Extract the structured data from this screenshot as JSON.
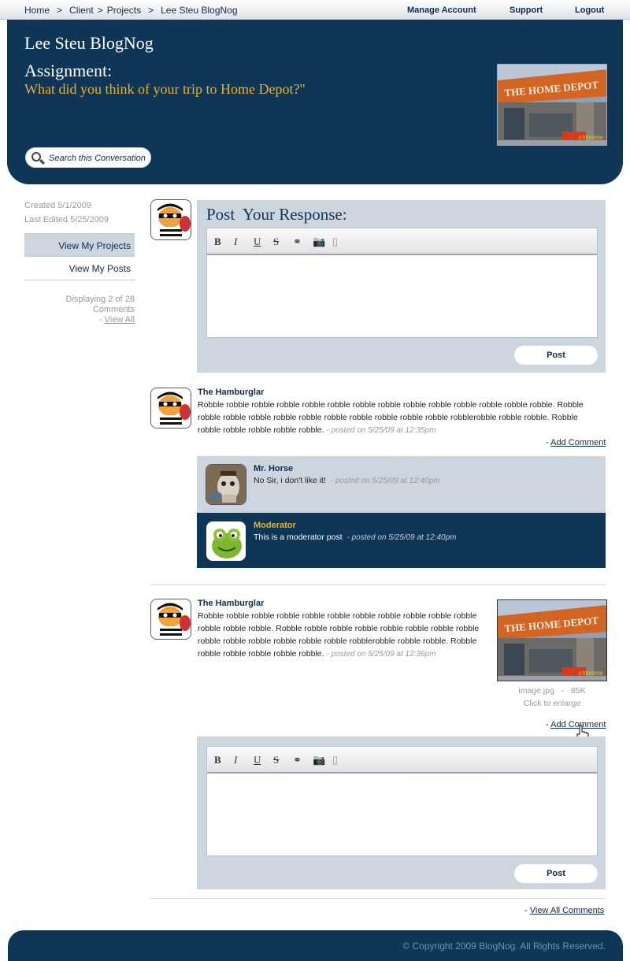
{
  "topnav": {
    "crumbs": [
      "Home",
      "Client",
      "Projects",
      "Lee Steu BlogNog"
    ],
    "sep": ">",
    "manage": "Manage Account",
    "support": "Support",
    "logout": "Logout"
  },
  "header": {
    "blog_title": "Lee Steu BlogNog",
    "assignment_label": "Assignment:",
    "assignment_question": "What did you think of your trip to Home Depot?\"",
    "search_label": "Search this Conversation",
    "photo_sign": "THE HOME DEPOT",
    "photo_date": "07/23/2009"
  },
  "sidebar": {
    "created": "Created 5/1/2009",
    "edited": "Last Edited 5/25/2009",
    "nav": [
      "View My Projects",
      "View My Posts"
    ],
    "displaying": "Displaying 2 of 28 Comments",
    "view_all_prefix": "- ",
    "view_all": "View All"
  },
  "response": {
    "title": "Post  Your Response:",
    "post_label": "Post"
  },
  "toolbar": {
    "bold": "B",
    "italic": "I",
    "underline": "U",
    "strike": "S"
  },
  "posts": [
    {
      "author": "The Hamburglar",
      "text": "Robble robble robble robble robble robble robble robble robble robble robble robble robble robble. Robble robble robble robble robble robble robble robble robble robble robble robblerobble robble robble. Robble robble robble robble robble robble.",
      "stamp": "- posted on 5/25/09 at 12:35pm",
      "add_prefix": "- ",
      "add_comment": "Add Comment"
    },
    {
      "author": "The Hamburglar",
      "text": "Robble robble robble robble robble robble robble robble robble robble robble robble robble robble. Robble robble robble robble robble robble robble robble robble robble robble robble robble robble robblerobble robble robble.  Robble robble robble robble robble robble.",
      "stamp": "- posted on 5/25/09 at 12:36pm",
      "add_prefix": "- ",
      "add_comment": "Add Comment",
      "attachment": {
        "name": "image.jpg",
        "sep": "-",
        "size": "85K",
        "hint": "Click to enlarge"
      }
    }
  ],
  "comments": [
    {
      "author": "Mr. Horse",
      "text": "No Sir, i don't like it!",
      "stamp": "- posted on 5/25/09 at 12:40pm"
    },
    {
      "author": "Moderator",
      "text": "This is a moderator post",
      "stamp": "- posted on 5/25/09 at 12:40pm"
    }
  ],
  "reply": {
    "post_label": "Post"
  },
  "view_all_comments_prefix": "- ",
  "view_all_comments": "View All Comments",
  "footer": "© Copyright 2009 BlogNog. All Rights Reserved.",
  "colors": {
    "navy": "#0f3557",
    "gold": "#e7b130",
    "panel": "#cdd5de",
    "orange": "#e5641c"
  }
}
